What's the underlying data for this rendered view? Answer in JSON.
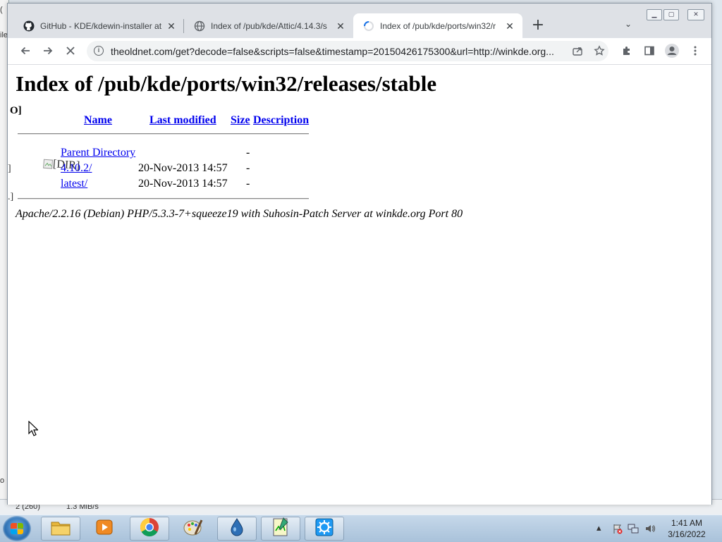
{
  "background": {
    "left_fragments": [
      "(",
      "ile",
      "o"
    ],
    "status_fragments": [
      "2 (260)",
      "1.3 MiB/s"
    ]
  },
  "tabs": [
    {
      "title": "GitHub - KDE/kdewin-installer at",
      "icon": "github-icon",
      "active": false
    },
    {
      "title": "Index of /pub/kde/Attic/4.14.3/s",
      "icon": "globe-icon",
      "active": false
    },
    {
      "title": "Index of /pub/kde/ports/win32/r",
      "icon": "loading-spinner-icon",
      "active": true
    }
  ],
  "toolbar": {
    "url": "theoldnet.com/get?decode=false&scripts=false&timestamp=20150426175300&url=http://winkde.org..."
  },
  "page": {
    "title": "Index of /pub/kde/ports/win32/releases/stable",
    "fragment": "O]",
    "columns": {
      "name": "Name",
      "last_modified": "Last modified",
      "size": "Size",
      "description": "Description"
    },
    "rows": [
      {
        "name": "Parent Directory",
        "modified": "",
        "size": "-",
        "icon_left": "",
        "icon_alt": ""
      },
      {
        "name": "4.10.2/",
        "modified": "20-Nov-2013 14:57",
        "size": "-",
        "icon_left": "]",
        "icon_alt": "[DIR]"
      },
      {
        "name": "latest/",
        "modified": "20-Nov-2013 14:57",
        "size": "-",
        "icon_left": ".]",
        "icon_alt": ""
      }
    ],
    "signature": "Apache/2.2.16 (Debian) PHP/5.3.3-7+squeeze19 with Suhosin-Patch Server at winkde.org Port 80"
  },
  "taskbar": {
    "apps": [
      "explorer-icon",
      "media-player-icon",
      "chrome-icon",
      "paint-icon",
      "droplet-icon",
      "notepad-icon",
      "kde-icon"
    ],
    "clock_time": "1:41 AM",
    "clock_date": "3/16/2022"
  }
}
